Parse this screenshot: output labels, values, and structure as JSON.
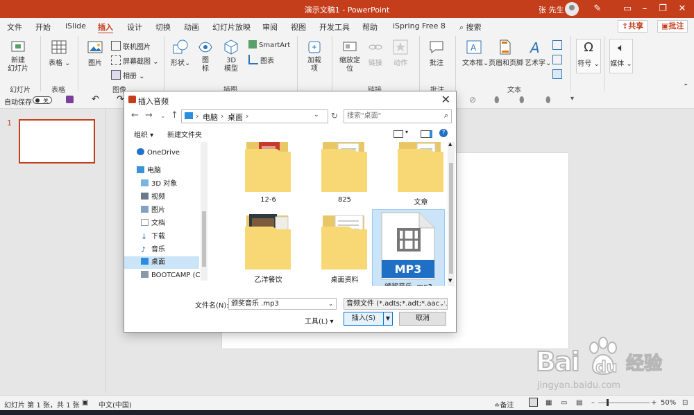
{
  "window": {
    "title": "演示文稿1 - PowerPoint",
    "user": "张 先生"
  },
  "tabs": [
    "文件",
    "开始",
    "iSlide",
    "插入",
    "设计",
    "切换",
    "动画",
    "幻灯片放映",
    "审阅",
    "视图",
    "开发工具",
    "帮助",
    "iSpring Free 8"
  ],
  "active_tab": "插入",
  "search_tab": "搜索",
  "share_label": "共享",
  "comment_label": "批注",
  "ribbon": {
    "new_slide": "新建\n幻灯片",
    "table": "表格",
    "picture": "图片",
    "online_picture": "联机图片",
    "screenshot": "屏幕截图",
    "album": "相册",
    "shapes": "形状",
    "icons": "图\n标",
    "model3d": "3D\n模型",
    "smartart": "SmartArt",
    "chart": "图表",
    "addins": "加载\n项",
    "zoom": "缩放定\n位",
    "link": "链接",
    "action": "动作",
    "comment": "批注",
    "textbox": "文本框",
    "header_footer": "页眉和页脚",
    "wordart": "艺术字",
    "symbol": "符号",
    "media": "媒体",
    "groups": {
      "slides": "幻灯片",
      "tables": "表格",
      "images": "图像",
      "illustrations": "插图",
      "links": "链接",
      "comments": "批注",
      "text": "文本"
    }
  },
  "qat": {
    "autosave": "自动保存",
    "toggle": "关"
  },
  "slide_panel": {
    "slide_number": "1"
  },
  "dialog": {
    "title": "插入音频",
    "breadcrumb": [
      "电脑",
      "桌面"
    ],
    "search_placeholder": "搜索\"桌面\"",
    "organize": "组织",
    "new_folder": "新建文件夹",
    "nav": [
      {
        "label": "OneDrive",
        "icon": "cloud-icon"
      },
      {
        "label": "电脑",
        "icon": "computer-icon"
      },
      {
        "label": "3D 对象",
        "icon": "cube-icon"
      },
      {
        "label": "视频",
        "icon": "video-icon"
      },
      {
        "label": "图片",
        "icon": "picture-icon"
      },
      {
        "label": "文档",
        "icon": "document-icon"
      },
      {
        "label": "下载",
        "icon": "download-icon"
      },
      {
        "label": "音乐",
        "icon": "music-icon"
      },
      {
        "label": "桌面",
        "icon": "desktop-icon"
      },
      {
        "label": "BOOTCAMP (C:",
        "icon": "drive-icon"
      }
    ],
    "selected_nav": "桌面",
    "files": [
      {
        "name": "12-6",
        "type": "folder"
      },
      {
        "name": "825",
        "type": "folder"
      },
      {
        "name": "文章",
        "type": "folder"
      },
      {
        "name": "乙洋餐饮",
        "type": "folder"
      },
      {
        "name": "桌面资料",
        "type": "folder"
      },
      {
        "name": "颁奖音乐 .mp3",
        "type": "mp3"
      }
    ],
    "mp3_badge": "MP3",
    "filename_label": "文件名(N):",
    "filename_value": "颁奖音乐 .mp3",
    "filetype_value": "音频文件 (*.adts;*.adt;*.aac;*.a",
    "tools": "工具(L)",
    "insert": "插入(S)",
    "cancel": "取消"
  },
  "status": {
    "slide_info": "幻灯片 第 1 张，共 1 张",
    "language": "中文(中国)",
    "notes": "备注",
    "zoom": "50%"
  },
  "watermark": {
    "brand": "Bai",
    "brand2": "du",
    "chinese": "经验",
    "url": "jingyan.baidu.com"
  },
  "colors": {
    "accent": "#c43e1c",
    "selection": "#cce4f7",
    "folder": "#f8d775"
  }
}
